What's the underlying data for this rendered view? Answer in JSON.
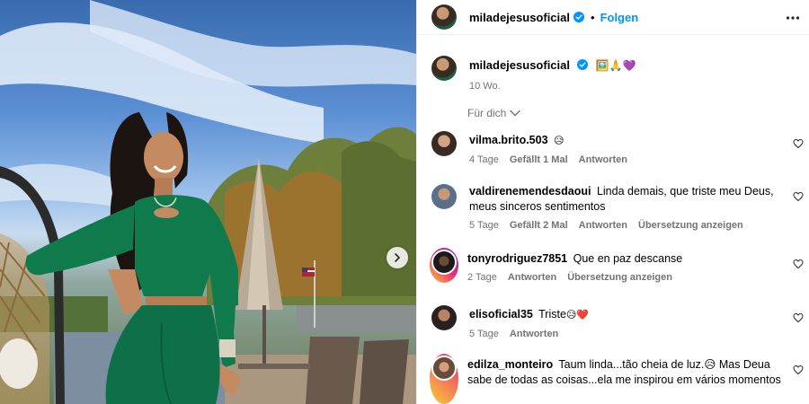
{
  "post": {
    "author": "miladejesusoficial",
    "follow_label": "Folgen",
    "separator": "•",
    "caption_emojis": "🖼️🙏💜",
    "caption_time": "10 Wo.",
    "sort_label": "Für dich"
  },
  "icons": {
    "verified": "verified-badge-icon",
    "more": "more-options-icon",
    "heart": "heart-outline-icon",
    "next": "chevron-right-icon",
    "chevron_down": "chevron-down-icon"
  },
  "colors": {
    "accent": "#0095f6",
    "muted": "#737373",
    "outfit": "#0f7a4c"
  },
  "comments": [
    {
      "user": "vilma.brito.503",
      "text": "",
      "emoji": "😥",
      "time": "4 Tage",
      "likes": "Gefällt 1 Mal",
      "reply": "Antworten",
      "translate": ""
    },
    {
      "user": "valdirenemendesdaoui",
      "text": "Linda demais, que triste meu Deus, meus sinceros sentimentos",
      "emoji": "",
      "time": "5 Tage",
      "likes": "Gefällt 2 Mal",
      "reply": "Antworten",
      "translate": "Übersetzung anzeigen"
    },
    {
      "user": "tonyrodriguez7851",
      "text": "Que en paz descanse",
      "emoji": "",
      "time": "2 Tage",
      "likes": "",
      "reply": "Antworten",
      "translate": "Übersetzung anzeigen"
    },
    {
      "user": "elisoficial35",
      "text": "Triste",
      "emoji": "😥❤️",
      "time": "5 Tage",
      "likes": "",
      "reply": "Antworten",
      "translate": ""
    },
    {
      "user": "edilza_monteiro",
      "text": "Taum linda...tão cheia de luz.😥 Mas Deua sabe de todas as coisas...ela me inspirou em vários momentos",
      "emoji": "",
      "time": "",
      "likes": "",
      "reply": "",
      "translate": ""
    }
  ]
}
